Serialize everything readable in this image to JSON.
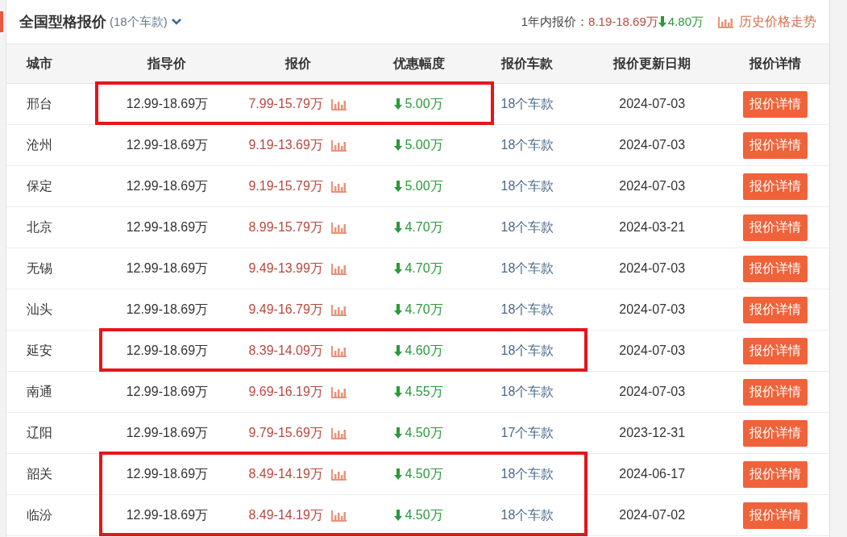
{
  "header": {
    "title": "全国型格报价",
    "count": "(18个车款)",
    "year_label": "1年内报价：",
    "year_range": "8.19-18.69万",
    "year_drop": "4.80万",
    "history_link": "历史价格走势"
  },
  "table": {
    "columns": [
      "城市",
      "指导价",
      "报价",
      "优惠幅度",
      "报价车款",
      "报价更新日期",
      "报价详情"
    ],
    "rows": [
      {
        "city": "邢台",
        "guide": "12.99-18.69万",
        "quote": "7.99-15.79万",
        "discount": "5.00万",
        "models": "18个车款",
        "date": "2024-07-03",
        "button": "报价详情",
        "highlighted": true,
        "highlight_wide": false
      },
      {
        "city": "沧州",
        "guide": "12.99-18.69万",
        "quote": "9.19-13.69万",
        "discount": "5.00万",
        "models": "18个车款",
        "date": "2024-07-03",
        "button": "报价详情",
        "highlighted": false
      },
      {
        "city": "保定",
        "guide": "12.99-18.69万",
        "quote": "9.19-15.79万",
        "discount": "5.00万",
        "models": "18个车款",
        "date": "2024-07-03",
        "button": "报价详情",
        "highlighted": false
      },
      {
        "city": "北京",
        "guide": "12.99-18.69万",
        "quote": "8.99-15.79万",
        "discount": "4.70万",
        "models": "18个车款",
        "date": "2024-03-21",
        "button": "报价详情",
        "highlighted": false
      },
      {
        "city": "无锡",
        "guide": "12.99-18.69万",
        "quote": "9.49-13.99万",
        "discount": "4.70万",
        "models": "18个车款",
        "date": "2024-07-03",
        "button": "报价详情",
        "highlighted": false
      },
      {
        "city": "汕头",
        "guide": "12.99-18.69万",
        "quote": "9.49-16.79万",
        "discount": "4.70万",
        "models": "18个车款",
        "date": "2024-07-03",
        "button": "报价详情",
        "highlighted": false
      },
      {
        "city": "延安",
        "guide": "12.99-18.69万",
        "quote": "8.39-14.09万",
        "discount": "4.60万",
        "models": "18个车款",
        "date": "2024-07-03",
        "button": "报价详情",
        "highlighted": true,
        "highlight_wide": true
      },
      {
        "city": "南通",
        "guide": "12.99-18.69万",
        "quote": "9.69-16.19万",
        "discount": "4.55万",
        "models": "18个车款",
        "date": "2024-07-03",
        "button": "报价详情",
        "highlighted": false
      },
      {
        "city": "辽阳",
        "guide": "12.99-18.69万",
        "quote": "9.79-15.69万",
        "discount": "4.50万",
        "models": "17个车款",
        "date": "2023-12-31",
        "button": "报价详情",
        "highlighted": false
      },
      {
        "city": "韶关",
        "guide": "12.99-18.69万",
        "quote": "8.49-14.19万",
        "discount": "4.50万",
        "models": "18个车款",
        "date": "2024-06-17",
        "button": "报价详情",
        "highlighted": true,
        "highlight_wide": true
      },
      {
        "city": "临汾",
        "guide": "12.99-18.69万",
        "quote": "8.49-14.19万",
        "discount": "4.50万",
        "models": "18个车款",
        "date": "2024-07-02",
        "button": "报价详情",
        "highlighted": true,
        "highlight_wide": true
      }
    ]
  }
}
